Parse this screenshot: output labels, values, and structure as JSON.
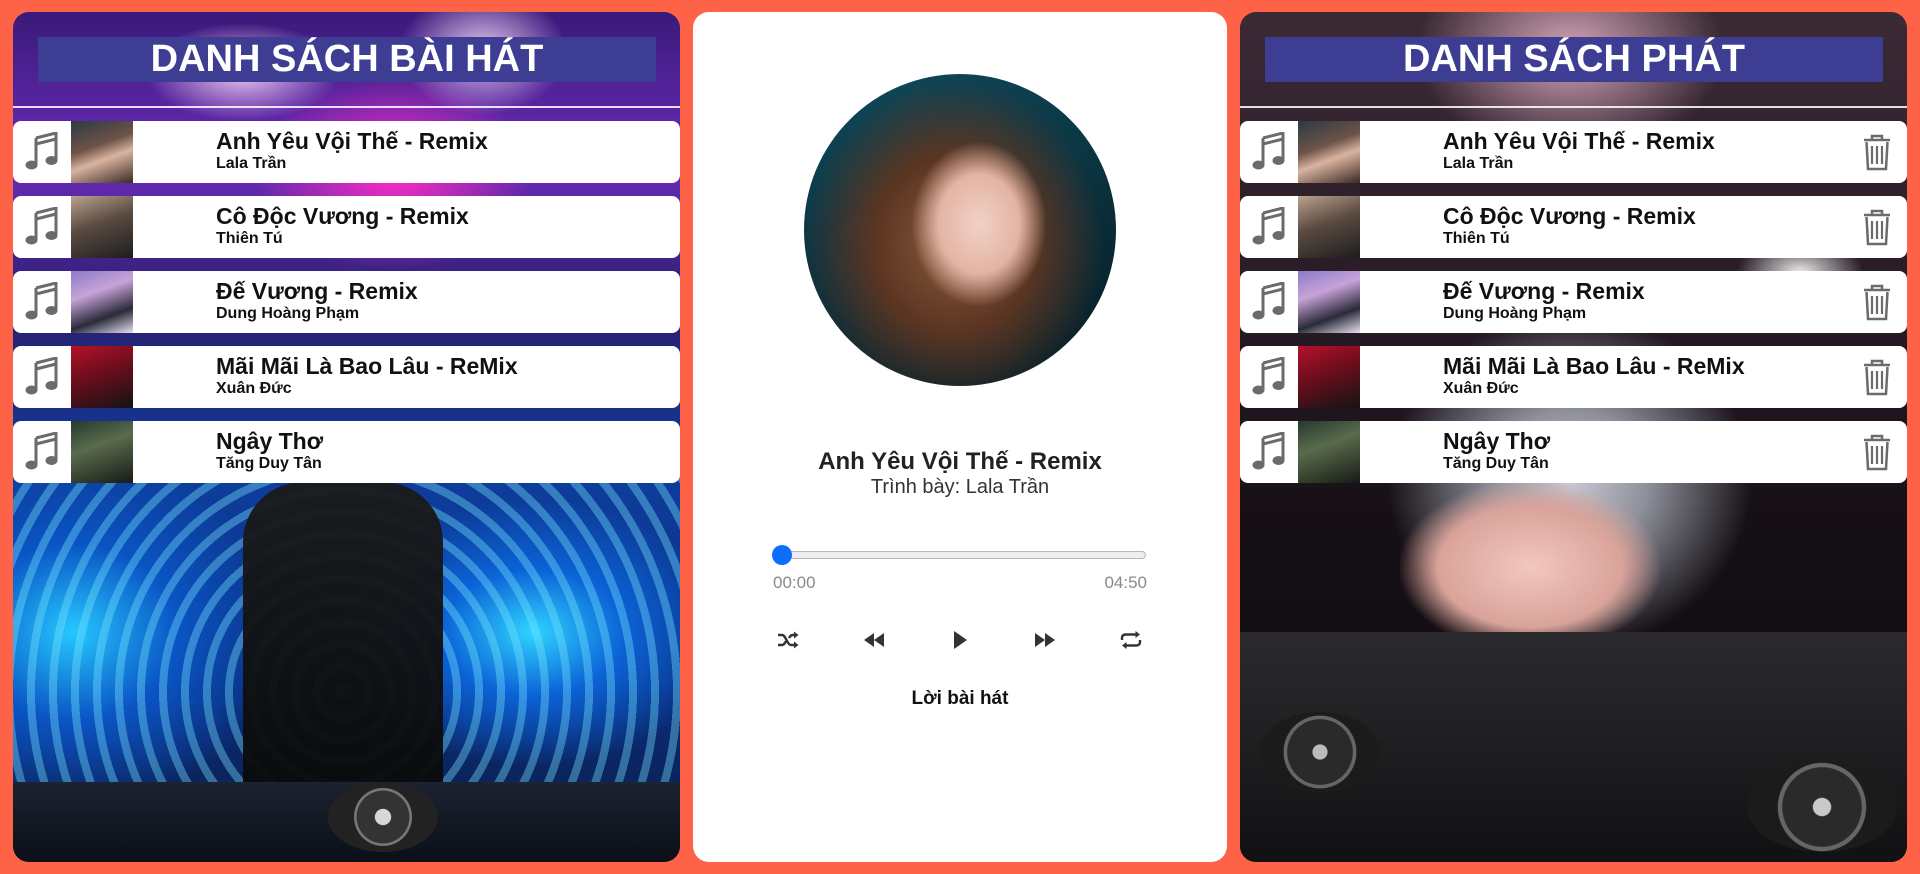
{
  "left_panel": {
    "title": "DANH SÁCH BÀI HÁT",
    "songs": [
      {
        "title": "Anh Yêu Vội Thế - Remix",
        "artist": "Lala Trần"
      },
      {
        "title": "Cô Độc Vương - Remix",
        "artist": "Thiên Tú"
      },
      {
        "title": "Đế Vương - Remix",
        "artist": "Dung Hoàng Phạm"
      },
      {
        "title": "Mãi Mãi Là Bao Lâu - ReMix",
        "artist": "Xuân Đức"
      },
      {
        "title": "Ngây Thơ",
        "artist": "Tăng Duy Tân"
      }
    ]
  },
  "player": {
    "title": "Anh Yêu Vội Thế - Remix",
    "artist_line": "Trình bày: Lala Trần",
    "current_time": "00:00",
    "duration": "04:50",
    "progress_percent": 0,
    "lyrics_label": "Lời bài hát",
    "accent_color": "#0d6efd"
  },
  "right_panel": {
    "title": "DANH SÁCH PHÁT",
    "songs": [
      {
        "title": "Anh Yêu Vội Thế - Remix",
        "artist": "Lala Trần"
      },
      {
        "title": "Cô Độc Vương - Remix",
        "artist": "Thiên Tú"
      },
      {
        "title": "Đế Vương - Remix",
        "artist": "Dung Hoàng Phạm"
      },
      {
        "title": "Mãi Mãi Là Bao Lâu - ReMix",
        "artist": "Xuân Đức"
      },
      {
        "title": "Ngây Thơ",
        "artist": "Tăng Duy Tân"
      }
    ]
  },
  "icons": {
    "song_item": "music-note-icon",
    "remove": "trash-icon",
    "controls": [
      "shuffle-icon",
      "previous-icon",
      "play-icon",
      "next-icon",
      "repeat-icon"
    ]
  },
  "colors": {
    "page_background": "#ff6347",
    "header_background": "#3d3d93"
  }
}
